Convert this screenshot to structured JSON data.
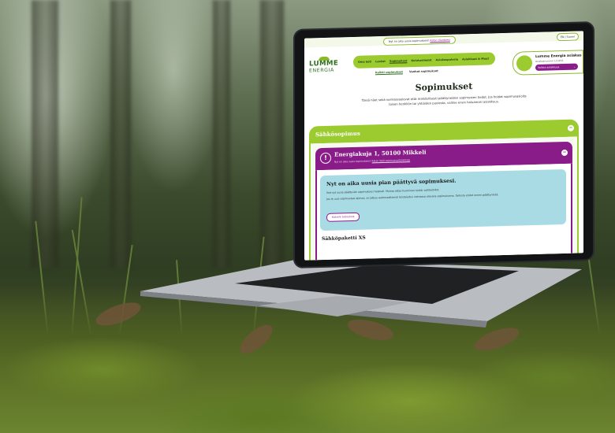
{
  "site": {
    "notice_text": "Nyt on aika uusia sopimuksesi!",
    "notice_link": "Katso tilanteesi",
    "logo_line1": "LUMME",
    "logo_line2": "ENERGIA",
    "language": "EN | Suomi",
    "nav": [
      "Oma koti",
      "Laskut",
      "Sopimukset",
      "Kulutustiedot",
      "Asiakaspalvelu",
      "Asiakkaat & Muut"
    ],
    "nav_active_index": 2,
    "subnav": [
      "Kaikki sopimukset",
      "Vanhat sopimukset"
    ],
    "account_title": "Lumme Energia asiakas",
    "account_sub": "Asiakasnumero 123456",
    "account_select": "Valitse asiakkuus"
  },
  "page": {
    "title": "Sopimukset",
    "intro": "Tässä näet sekä voimassaolevat että mahdollisesti päättyneiden sopimusten tiedot. Jos hoidat sopimusasioita toisen henkilön tai yhtiöiden puolesta, valitse ensin haluamasi asiakkuus."
  },
  "section": {
    "title": "Sähkösopimus",
    "toggle": "−"
  },
  "contract": {
    "title": "Energiakuja 1, 50100 Mikkeli",
    "sub": "Nyt on aika uusia sopimuksesi!",
    "sub_link": "Katso lisää sopimusvaihtoehtoja",
    "toggle": "−"
  },
  "alert": {
    "title": "Nyt on aika uusia pian päättyvä sopimuksesi.",
    "p1": "Voit nyt uusia päättyvän sopimuksesi helposti. Muista ottaa huomioon kaikki vaihtoehdot.",
    "p2": "Jos et uusi sopimustasi ajoissa, se jatkuu automaattisesti toistaiseksi voimassa olevana sopimuksena. Tarkista ehdot ennen päättymistä.",
    "button": "Katsele tarjouksia"
  },
  "package": {
    "title": "Sähköpaketti XS"
  },
  "colors": {
    "green": "#9ccb2f",
    "purple": "#8a1c8a",
    "info": "#a9dbe4"
  }
}
